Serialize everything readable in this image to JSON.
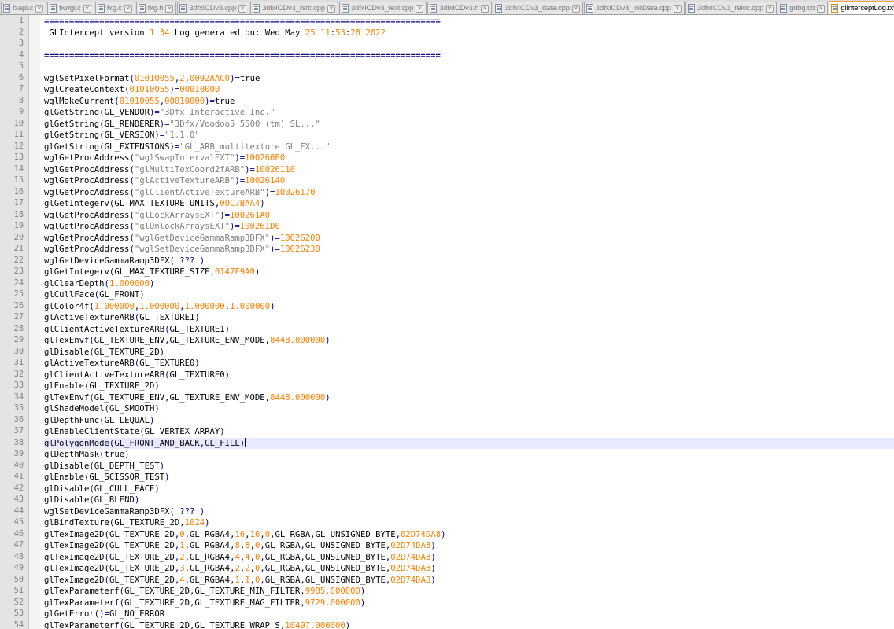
{
  "tabs": [
    {
      "label": "fxapi.c",
      "active": false
    },
    {
      "label": "fxwgl.c",
      "active": false
    },
    {
      "label": "fxg.c",
      "active": false
    },
    {
      "label": "fxg.h",
      "active": false
    },
    {
      "label": "3dfxICDv3.cpp",
      "active": false
    },
    {
      "label": "3dfxICDv3_rsrc.cpp",
      "active": false
    },
    {
      "label": "3dfxICDv3_text.cpp",
      "active": false
    },
    {
      "label": "3dfxICDv3.h",
      "active": false
    },
    {
      "label": "3dfxICDv3_data.cpp",
      "active": false
    },
    {
      "label": "3dfxICDv3_InitData.cpp",
      "active": false
    },
    {
      "label": "3dfxICDv3_reloc.cpp",
      "active": false
    },
    {
      "label": "gdbg.txt",
      "active": false
    },
    {
      "label": "glInterceptLog.txt",
      "active": true
    }
  ],
  "editor": {
    "current_line": 38,
    "lines": [
      {
        "n": "1",
        "text": "==============================================================================="
      },
      {
        "n": "2",
        "text": " GLIntercept version 1.34 Log generated on: Wed May 25 11:53:28 2022"
      },
      {
        "n": "3",
        "text": ""
      },
      {
        "n": "4",
        "text": "==============================================================================="
      },
      {
        "n": "5",
        "text": ""
      },
      {
        "n": "6",
        "text": "wglSetPixelFormat(01010055,2,0092AAC0)=true"
      },
      {
        "n": "7",
        "text": "wglCreateContext(01010055)=00010000"
      },
      {
        "n": "8",
        "text": "wglMakeCurrent(01010055,00010000)=true"
      },
      {
        "n": "9",
        "text": "glGetString(GL_VENDOR)=\"3Dfx Interactive Inc.\""
      },
      {
        "n": "10",
        "text": "glGetString(GL_RENDERER)=\"3Dfx/Voodoo5 5500 (tm) SL...\""
      },
      {
        "n": "11",
        "text": "glGetString(GL_VERSION)=\"1.1.0\""
      },
      {
        "n": "12",
        "text": "glGetString(GL_EXTENSIONS)=\"GL_ARB_multitexture GL_EX...\""
      },
      {
        "n": "13",
        "text": "wglGetProcAddress(\"wglSwapIntervalEXT\")=100260E0"
      },
      {
        "n": "14",
        "text": "wglGetProcAddress(\"glMultiTexCoord2fARB\")=10026110"
      },
      {
        "n": "15",
        "text": "wglGetProcAddress(\"glActiveTextureARB\")=10026140"
      },
      {
        "n": "16",
        "text": "wglGetProcAddress(\"glClientActiveTextureARB\")=10026170"
      },
      {
        "n": "17",
        "text": "glGetIntegerv(GL_MAX_TEXTURE_UNITS,00C7BAA4)"
      },
      {
        "n": "18",
        "text": "wglGetProcAddress(\"glLockArraysEXT\")=100261A0"
      },
      {
        "n": "19",
        "text": "wglGetProcAddress(\"glUnlockArraysEXT\")=100261D0"
      },
      {
        "n": "20",
        "text": "wglGetProcAddress(\"wglGetDeviceGammaRamp3DFX\")=10026200"
      },
      {
        "n": "21",
        "text": "wglGetProcAddress(\"wglSetDeviceGammaRamp3DFX\")=10026230"
      },
      {
        "n": "22",
        "text": "wglGetDeviceGammaRamp3DFX( ??? )"
      },
      {
        "n": "23",
        "text": "glGetIntegerv(GL_MAX_TEXTURE_SIZE,0147F9A0)"
      },
      {
        "n": "24",
        "text": "glClearDepth(1.000000)"
      },
      {
        "n": "25",
        "text": "glCullFace(GL_FRONT)"
      },
      {
        "n": "26",
        "text": "glColor4f(1.000000,1.000000,1.000000,1.000000)"
      },
      {
        "n": "27",
        "text": "glActiveTextureARB(GL_TEXTURE1)"
      },
      {
        "n": "28",
        "text": "glClientActiveTextureARB(GL_TEXTURE1)"
      },
      {
        "n": "29",
        "text": "glTexEnvf(GL_TEXTURE_ENV,GL_TEXTURE_ENV_MODE,8448.000000)"
      },
      {
        "n": "30",
        "text": "glDisable(GL_TEXTURE_2D)"
      },
      {
        "n": "31",
        "text": "glActiveTextureARB(GL_TEXTURE0)"
      },
      {
        "n": "32",
        "text": "glClientActiveTextureARB(GL_TEXTURE0)"
      },
      {
        "n": "33",
        "text": "glEnable(GL_TEXTURE_2D)"
      },
      {
        "n": "34",
        "text": "glTexEnvf(GL_TEXTURE_ENV,GL_TEXTURE_ENV_MODE,8448.000000)"
      },
      {
        "n": "35",
        "text": "glShadeModel(GL_SMOOTH)"
      },
      {
        "n": "36",
        "text": "glDepthFunc(GL_LEQUAL)"
      },
      {
        "n": "37",
        "text": "glEnableClientState(GL_VERTEX_ARRAY)"
      },
      {
        "n": "38",
        "text": "glPolygonMode(GL_FRONT_AND_BACK,GL_FILL)"
      },
      {
        "n": "39",
        "text": "glDepthMask(true)"
      },
      {
        "n": "40",
        "text": "glDisable(GL_DEPTH_TEST)"
      },
      {
        "n": "41",
        "text": "glEnable(GL_SCISSOR_TEST)"
      },
      {
        "n": "42",
        "text": "glDisable(GL_CULL_FACE)"
      },
      {
        "n": "43",
        "text": "glDisable(GL_BLEND)"
      },
      {
        "n": "44",
        "text": "wglSetDeviceGammaRamp3DFX( ??? )"
      },
      {
        "n": "45",
        "text": "glBindTexture(GL_TEXTURE_2D,1024)"
      },
      {
        "n": "46",
        "text": "glTexImage2D(GL_TEXTURE_2D,0,GL_RGBA4,16,16,0,GL_RGBA,GL_UNSIGNED_BYTE,02D74DA8)"
      },
      {
        "n": "47",
        "text": "glTexImage2D(GL_TEXTURE_2D,1,GL_RGBA4,8,8,0,GL_RGBA,GL_UNSIGNED_BYTE,02D74DA8)"
      },
      {
        "n": "48",
        "text": "glTexImage2D(GL_TEXTURE_2D,2,GL_RGBA4,4,4,0,GL_RGBA,GL_UNSIGNED_BYTE,02D74DA8)"
      },
      {
        "n": "49",
        "text": "glTexImage2D(GL_TEXTURE_2D,3,GL_RGBA4,2,2,0,GL_RGBA,GL_UNSIGNED_BYTE,02D74DA8)"
      },
      {
        "n": "50",
        "text": "glTexImage2D(GL_TEXTURE_2D,4,GL_RGBA4,1,1,0,GL_RGBA,GL_UNSIGNED_BYTE,02D74DA8)"
      },
      {
        "n": "51",
        "text": "glTexParameterf(GL_TEXTURE_2D,GL_TEXTURE_MIN_FILTER,9985.000000)"
      },
      {
        "n": "52",
        "text": "glTexParameterf(GL_TEXTURE_2D,GL_TEXTURE_MAG_FILTER,9729.000000)"
      },
      {
        "n": "53",
        "text": "glGetError()=GL_NO_ERROR"
      },
      {
        "n": "54",
        "text": "glTexParameterf(GL_TEXTURE_2D,GL_TEXTURE_WRAP_S,10497.000000)"
      }
    ]
  },
  "colors": {
    "number": "#ff8000",
    "string": "#808080",
    "operator": "#000080",
    "current_line": "#e8e8ff",
    "active_tab_accent": "#f7a23b",
    "close_active": "#d9362b"
  }
}
